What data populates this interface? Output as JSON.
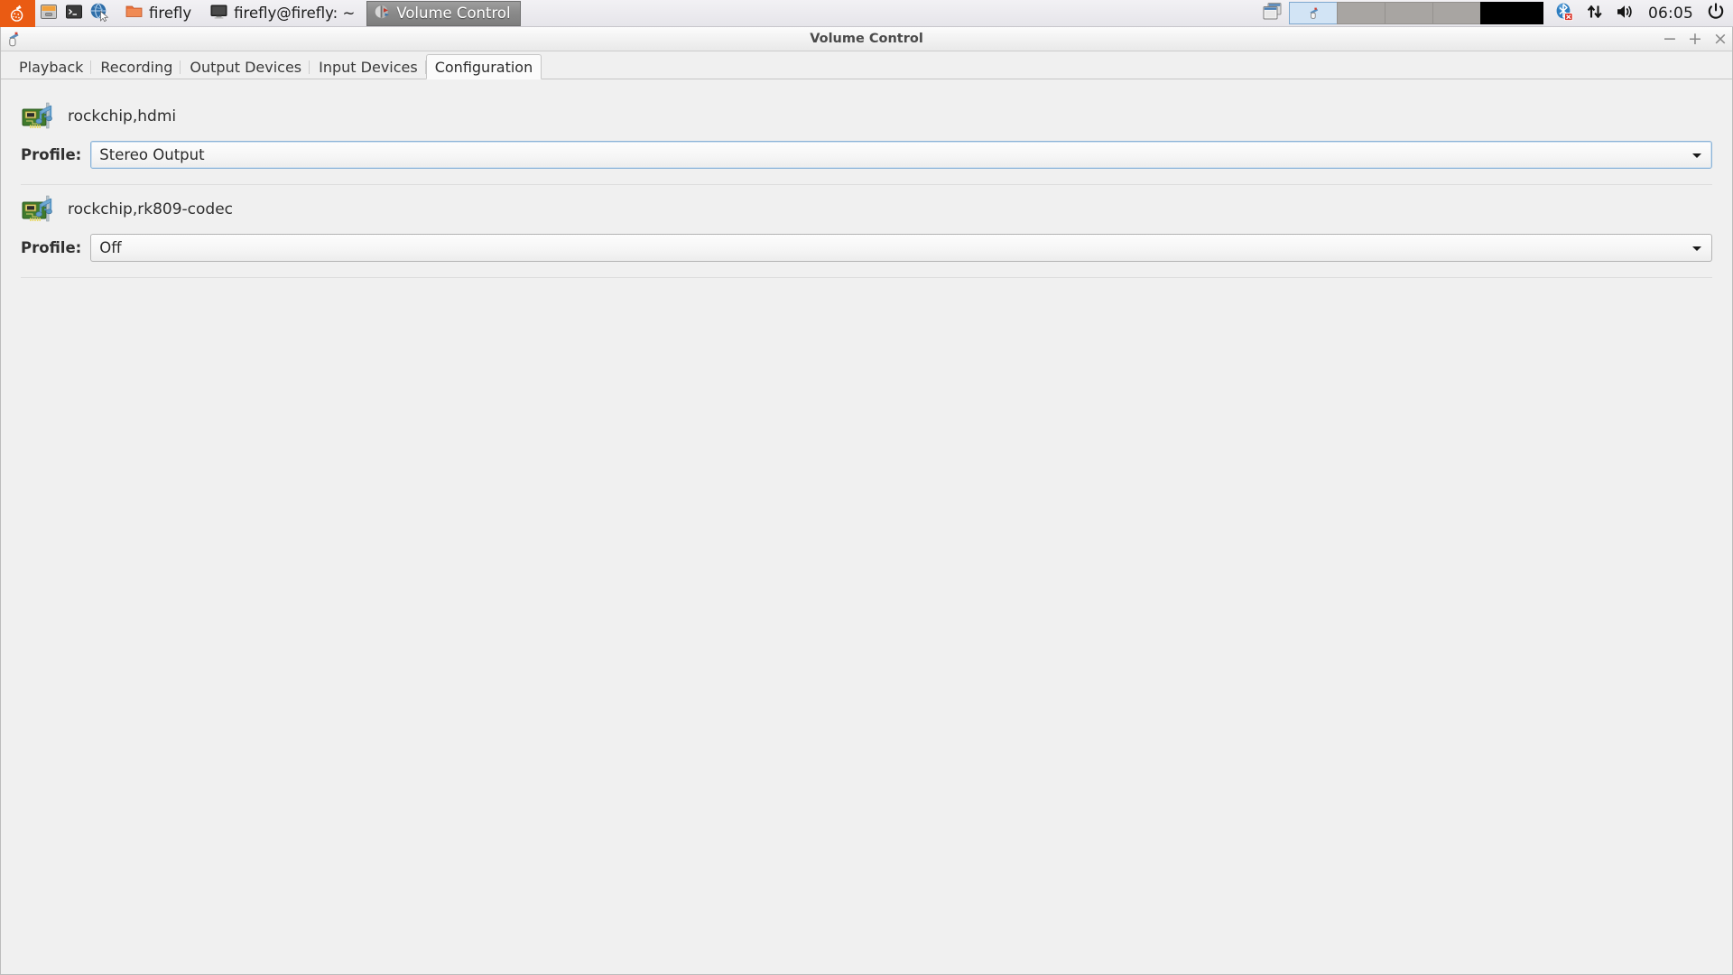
{
  "taskbar": {
    "menu_button": {
      "name": "application-menu-button",
      "icon": "flask-icon"
    },
    "launchers": [
      {
        "label": "File Manager",
        "icon": "file-manager-icon"
      },
      {
        "label": "Terminal",
        "icon": "terminal-icon"
      },
      {
        "label": "Web Browser",
        "icon": "web-browser-icon"
      }
    ],
    "tasks": [
      {
        "label": "firefly",
        "icon": "folder-icon",
        "active": false
      },
      {
        "label": "firefly@firefly: ~",
        "icon": "terminal-window-icon",
        "active": false
      },
      {
        "label": "Volume Control",
        "icon": "volume-control-icon",
        "active": true
      }
    ],
    "tray": [
      {
        "name": "bluetooth-disabled-icon"
      },
      {
        "name": "network-updown-icon"
      },
      {
        "name": "volume-icon"
      }
    ],
    "clock": "06:05",
    "power_button": "power-icon",
    "colors": {
      "menu_accent": "#ea5b13",
      "panel": "#ecebef",
      "active_task": "#8c8c8c"
    }
  },
  "window": {
    "title": "Volume Control",
    "icon": "volume-control-icon",
    "controls": {
      "minimize": "−",
      "maximize": "+",
      "close": "×"
    }
  },
  "tabs": [
    {
      "label": "Playback",
      "active": false
    },
    {
      "label": "Recording",
      "active": false
    },
    {
      "label": "Output Devices",
      "active": false
    },
    {
      "label": "Input Devices",
      "active": false
    },
    {
      "label": "Configuration",
      "active": true
    }
  ],
  "cards": [
    {
      "name": "rockchip,hdmi",
      "icon": "sound-card-icon",
      "profile_label": "Profile:",
      "profile_value": "Stereo Output",
      "focused": true
    },
    {
      "name": "rockchip,rk809-codec",
      "icon": "sound-card-icon",
      "profile_label": "Profile:",
      "profile_value": "Off",
      "focused": false
    }
  ]
}
